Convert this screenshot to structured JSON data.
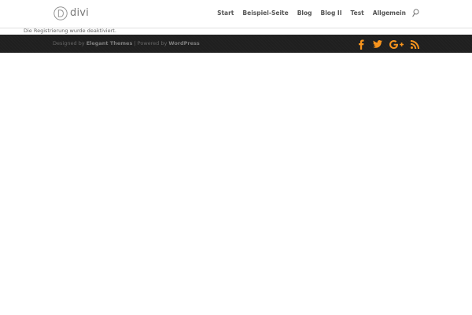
{
  "header": {
    "logo_text": "divi",
    "nav": {
      "items": [
        {
          "label": "Start"
        },
        {
          "label": "Beispiel-Seite"
        },
        {
          "label": "Blog"
        },
        {
          "label": "Blog II"
        },
        {
          "label": "Test"
        },
        {
          "label": "Allgemein"
        }
      ]
    },
    "search_icon": "search-icon"
  },
  "main": {
    "notice": "Die Registrierung wurde deaktiviert."
  },
  "footer": {
    "credits": {
      "designed_by": "Designed by",
      "elegant_themes": "Elegant Themes",
      "separator": " | Powered by ",
      "wordpress": "WordPress"
    },
    "social_icons": [
      "facebook-icon",
      "twitter-icon",
      "google-plus-icon",
      "rss-icon"
    ],
    "accent_color": "#f7941d",
    "background_color": "#1f1f1f"
  }
}
